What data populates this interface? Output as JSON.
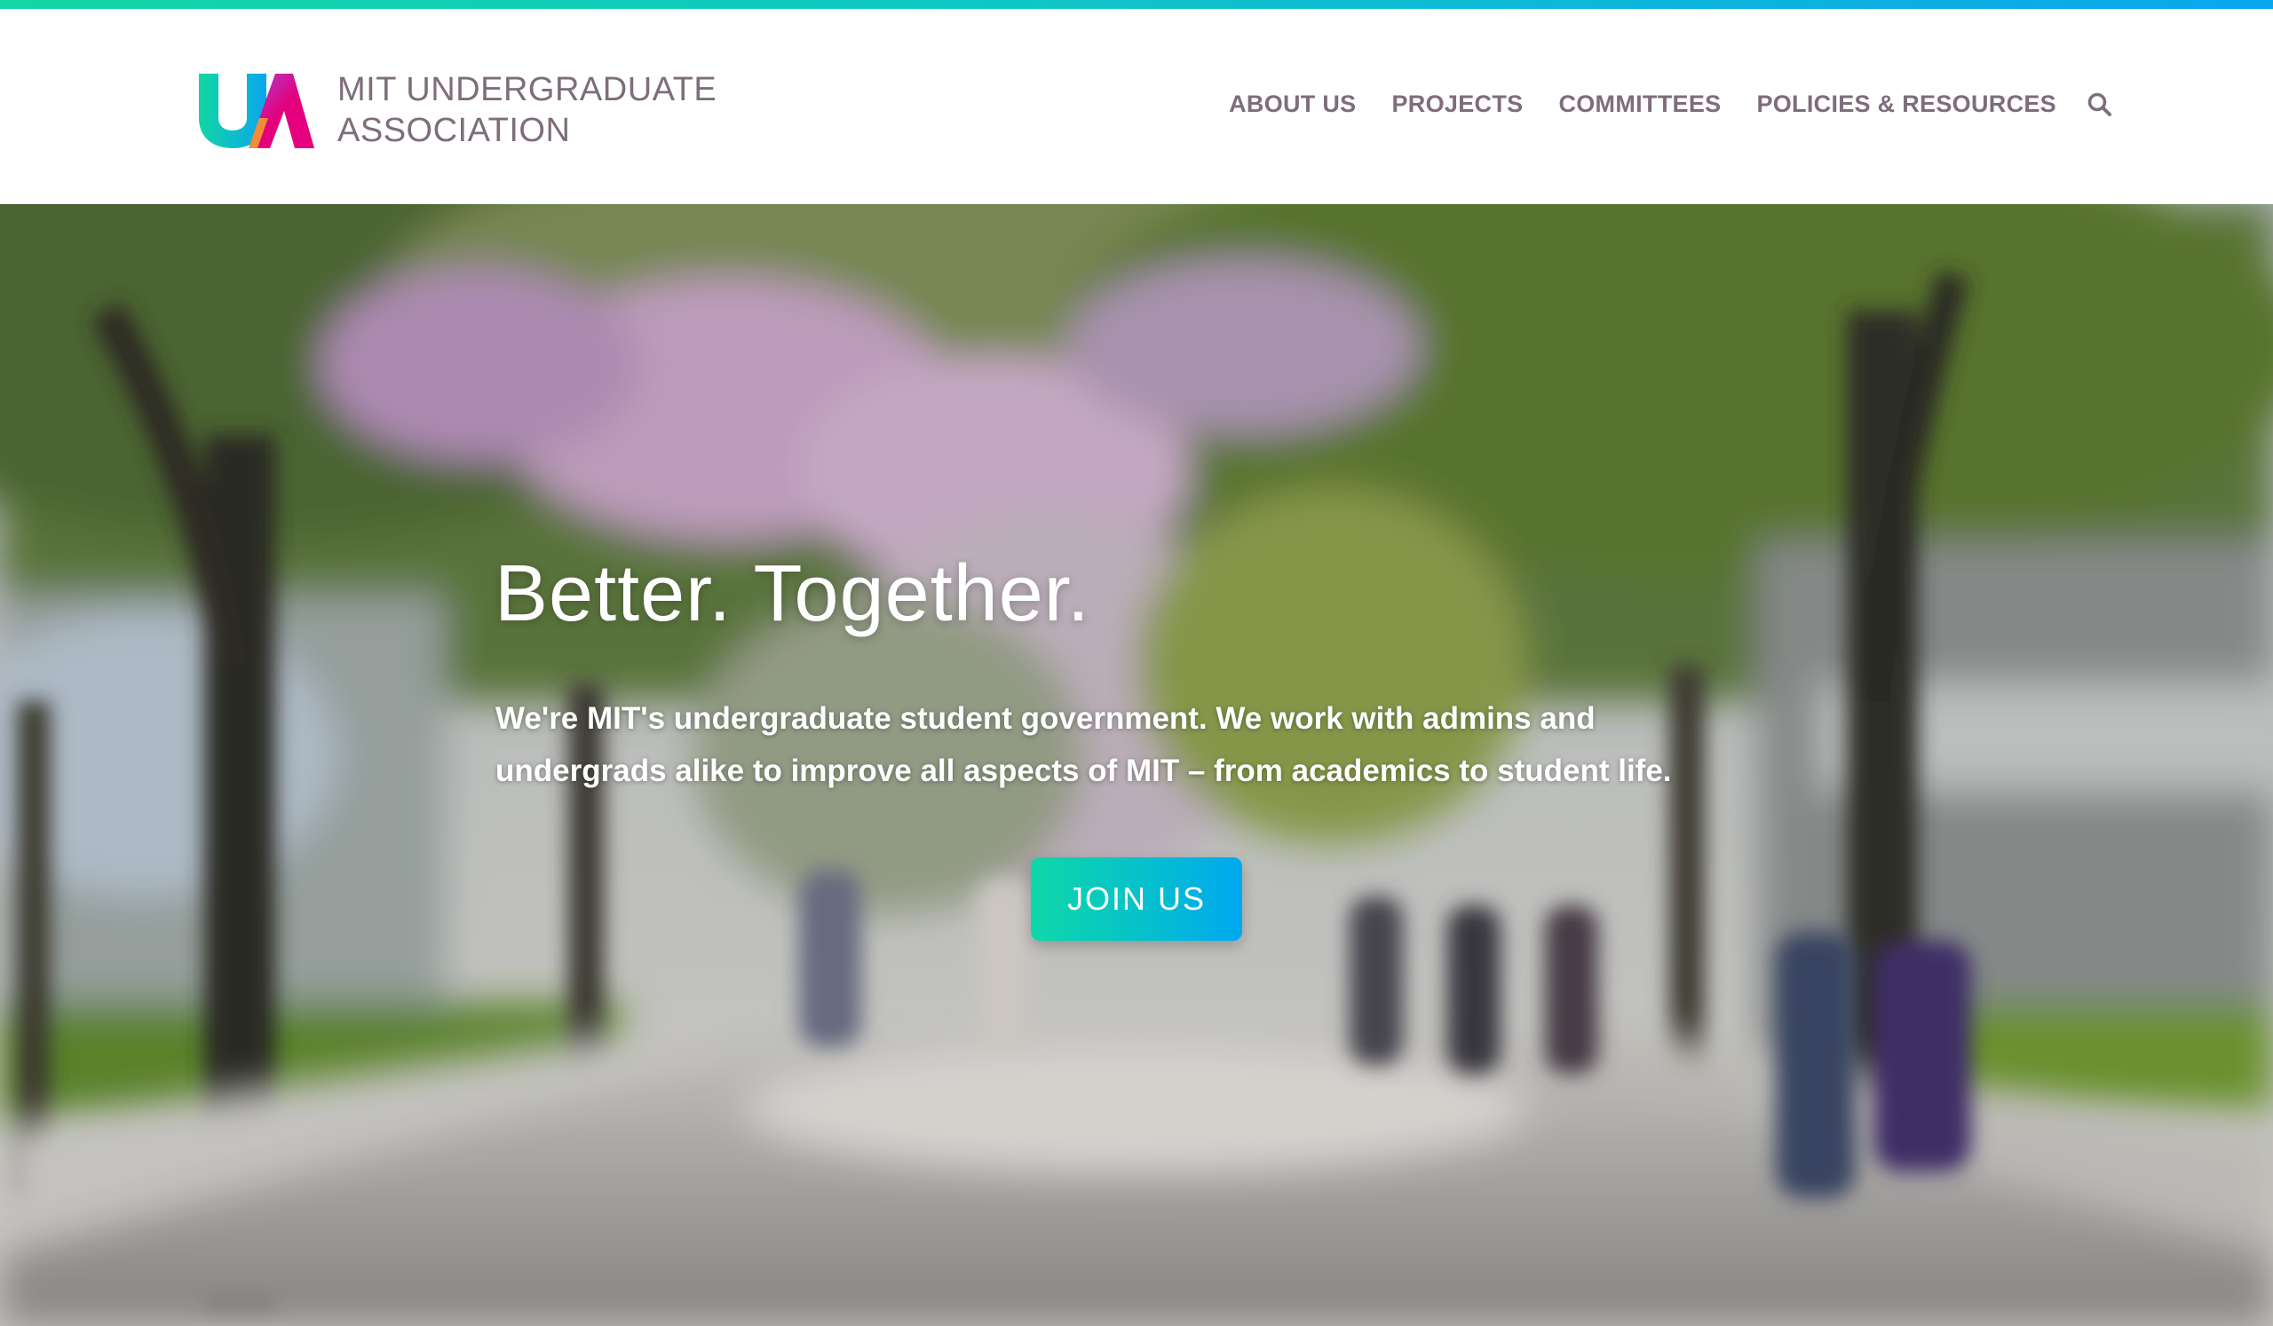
{
  "colors": {
    "brand_gradient_start": "#12d6a4",
    "brand_gradient_end": "#0aa6ee",
    "logo_magenta": "#e4007c",
    "text_mauve": "#7e6d7b",
    "white": "#ffffff"
  },
  "header": {
    "logo": {
      "icon": "ua-logo-icon",
      "line1": "MIT UNDERGRADUATE",
      "line2": "ASSOCIATION"
    },
    "nav": [
      {
        "label": "ABOUT US"
      },
      {
        "label": "PROJECTS"
      },
      {
        "label": "COMMITTEES"
      },
      {
        "label": "POLICIES & RESOURCES"
      }
    ],
    "search_icon": "search-icon"
  },
  "hero": {
    "background": "blurred-campus-walkway-photo",
    "title": "Better. Together.",
    "text": "We're MIT's undergraduate student government. We work with admins and undergrads alike to improve all aspects of MIT – from academics to student life.",
    "cta_label": "JOIN US"
  }
}
